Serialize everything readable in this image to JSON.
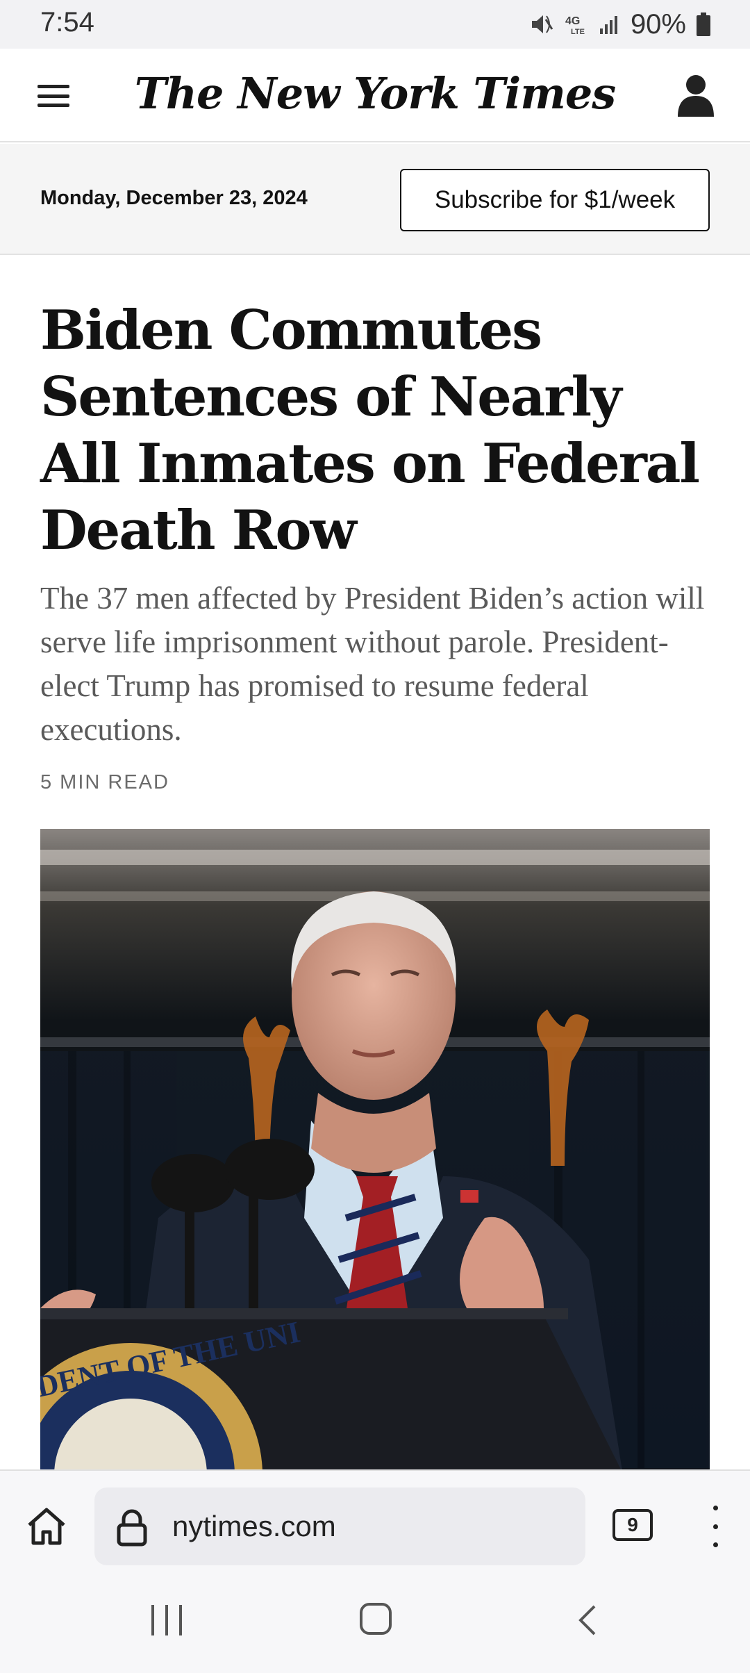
{
  "status_bar": {
    "time": "7:54",
    "battery": "90%",
    "icons": [
      "mute-icon",
      "4g-lte-icon",
      "signal-icon",
      "battery-icon"
    ]
  },
  "header": {
    "logo": "The New York Times",
    "menu_icon": "hamburger-menu-icon",
    "account_icon": "account-icon"
  },
  "date_bar": {
    "date": "Monday, December 23, 2024",
    "subscribe_label": "Subscribe for $1/week"
  },
  "article": {
    "headline": "Biden Commutes Sentences of Nearly All Inmates on Federal Death Row",
    "summary": "The 37 men affected by President Biden’s action will serve life imprisonment without parole. President-elect Trump has promised to resume federal executions.",
    "read_time": "5 MIN READ",
    "seal_text": "IDENT OF THE UNI"
  },
  "browser": {
    "url": "nytimes.com",
    "tab_count": "9"
  },
  "colors": {
    "text": "#121212",
    "summary_text": "#5a5a5a",
    "chrome_bg": "#f7f7f9",
    "date_bar_bg": "#f5f5f5"
  }
}
